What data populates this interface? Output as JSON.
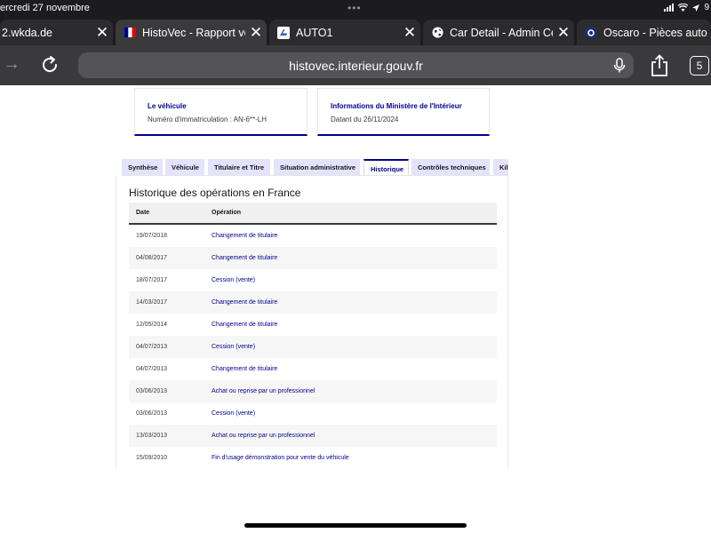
{
  "status": {
    "time": "ercredi 27 novembre",
    "battery": "9"
  },
  "tabs": [
    {
      "title": "2.wkda.de",
      "favicon": "none",
      "closable": true,
      "active": false
    },
    {
      "title": "HistoVec - Rapport ve",
      "favicon": "french-flag-icon",
      "closable": true,
      "active": true
    },
    {
      "title": "AUTO1",
      "favicon": "auto1-icon",
      "closable": true,
      "active": false
    },
    {
      "title": "Car Detail - Admin Cen",
      "favicon": "globe-icon",
      "closable": true,
      "active": false
    },
    {
      "title": "Oscaro - Pièces auto",
      "favicon": "oscaro-icon",
      "closable": false,
      "active": false
    }
  ],
  "toolbar": {
    "url": "histovec.interieur.gouv.fr",
    "tab_count": "5"
  },
  "cards": [
    {
      "title": "Le véhicule",
      "text": "Numéro d'immatriculation : AN-6**-LH"
    },
    {
      "title": "Informations du Ministère de l'Intérieur",
      "text": "Datant du 26/11/2024"
    }
  ],
  "page_tabs": [
    {
      "label": "Synthèse",
      "active": false
    },
    {
      "label": "Véhicule",
      "active": false
    },
    {
      "label": "Titulaire et Titre",
      "active": false
    },
    {
      "label": "Situation administrative",
      "active": false
    },
    {
      "label": "Historique",
      "active": true
    },
    {
      "label": "Contrôles techniques",
      "active": false
    },
    {
      "label": "Kil",
      "active": false
    }
  ],
  "history": {
    "title": "Historique des opérations en France",
    "headers": {
      "date": "Date",
      "operation": "Opération"
    },
    "rows": [
      {
        "date": "19/07/2018",
        "operation": "Changement de titulaire"
      },
      {
        "date": "04/08/2017",
        "operation": "Changement de titulaire"
      },
      {
        "date": "18/07/2017",
        "operation": "Cession (vente)"
      },
      {
        "date": "14/03/2017",
        "operation": "Changement de titulaire"
      },
      {
        "date": "12/05/2014",
        "operation": "Changement de titulaire"
      },
      {
        "date": "04/07/2013",
        "operation": "Cession (vente)"
      },
      {
        "date": "04/07/2013",
        "operation": "Changement de titulaire"
      },
      {
        "date": "03/06/2013",
        "operation": "Achat ou reprise par un professionnel"
      },
      {
        "date": "03/06/2013",
        "operation": "Cession (vente)"
      },
      {
        "date": "13/03/2013",
        "operation": "Achat ou reprise par un professionnel"
      },
      {
        "date": "15/09/2010",
        "operation": "Fin d'usage démonstration pour vente du véhicule"
      }
    ]
  },
  "colors": {
    "brand_blue": "#000091",
    "tab_bg": "#e3e3fd",
    "chrome_dark": "#1c1c1e"
  }
}
